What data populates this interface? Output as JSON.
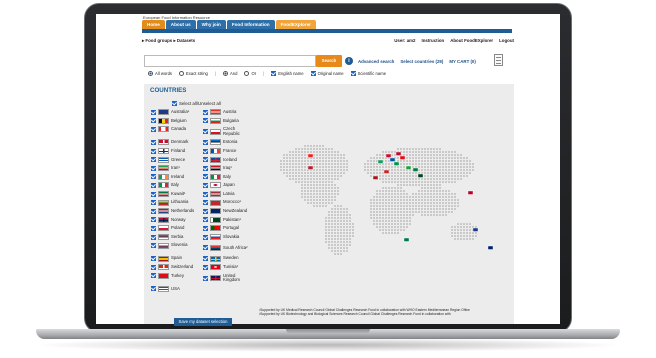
{
  "site": {
    "name": "European Food Information Resource",
    "tabs": [
      "Home",
      "About us",
      "Why join",
      "Food Information",
      "FoodEXplorer"
    ]
  },
  "breadcrumb": "▸ Food groups ▸ Datasets",
  "user_menu": [
    "User: am2",
    "Instruction",
    "About FoodEXplorer",
    "Logout"
  ],
  "search": {
    "placeholder": "",
    "button_label": "Search",
    "info_symbol": "i",
    "advanced_label": "Advanced search",
    "select_countries_label": "Select countries (29)",
    "cart_label": "MY CART (0)"
  },
  "options": {
    "all_words": "All words",
    "exact_string": "Exact string",
    "and": "And",
    "or": "Or",
    "english_name": "English name",
    "original_name": "Original name",
    "scientific_name": "Scientific name"
  },
  "countries_panel": {
    "title": "COUNTRIES",
    "select_all": "Select all/Unselect all",
    "save_button": "Save my dataset selection",
    "countries": [
      {
        "name": "Australia¹",
        "flag": "au"
      },
      {
        "name": "Austria",
        "flag": "at"
      },
      {
        "name": "Belgium",
        "flag": "be"
      },
      {
        "name": "Bulgaria",
        "flag": "bg"
      },
      {
        "name": "Canada",
        "flag": "ca"
      },
      {
        "name": "Czech Republic",
        "flag": "cz"
      },
      {
        "name": "Denmark",
        "flag": "dk"
      },
      {
        "name": "Estonia",
        "flag": "ee"
      },
      {
        "name": "Finland",
        "flag": "fi"
      },
      {
        "name": "France",
        "flag": "fr"
      },
      {
        "name": "Greece",
        "flag": "gr"
      },
      {
        "name": "Iceland",
        "flag": "is"
      },
      {
        "name": "Iran¹",
        "flag": "ir"
      },
      {
        "name": "Iraq¹",
        "flag": "iq"
      },
      {
        "name": "Ireland",
        "flag": "ie"
      },
      {
        "name": "Italy",
        "flag": "it"
      },
      {
        "name": "Italy",
        "flag": "it"
      },
      {
        "name": "Japan",
        "flag": "jp"
      },
      {
        "name": "Kuwait¹",
        "flag": "kw"
      },
      {
        "name": "Latvia",
        "flag": "lv"
      },
      {
        "name": "Lithuania",
        "flag": "lt"
      },
      {
        "name": "Morocco¹",
        "flag": "ma"
      },
      {
        "name": "Netherlands",
        "flag": "nl"
      },
      {
        "name": "NewZealand",
        "flag": "nz"
      },
      {
        "name": "Norway",
        "flag": "no"
      },
      {
        "name": "Pakistan¹",
        "flag": "pk"
      },
      {
        "name": "Poland",
        "flag": "pl"
      },
      {
        "name": "Portugal",
        "flag": "pt"
      },
      {
        "name": "Serbia",
        "flag": "rs"
      },
      {
        "name": "Slovakia",
        "flag": "sk"
      },
      {
        "name": "Slovenia",
        "flag": "si"
      },
      {
        "name": "South Africa²",
        "flag": "za"
      },
      {
        "name": "Spain",
        "flag": "es"
      },
      {
        "name": "Sweden",
        "flag": "se"
      },
      {
        "name": "Switzerland",
        "flag": "ch"
      },
      {
        "name": "Tunisia¹",
        "flag": "tn"
      },
      {
        "name": "Turkey",
        "flag": "tr"
      },
      {
        "name": "United Kingdom",
        "flag": "gb"
      },
      {
        "name": "USA",
        "flag": "us"
      }
    ]
  },
  "footnotes": [
    "¹Supported by UK Medical Research Council Global Challenges Research Fund in collaboration with WHO Eastern Mediterranean Region Office",
    "²Supported by UK Biotechnology and Biological Sciences Research Council Global Challenges Research Fund in collaboration with"
  ],
  "colors": {
    "accent_orange": "#e88a1a",
    "nav_blue": "#1e5c96",
    "panel_bg": "#ececec"
  }
}
